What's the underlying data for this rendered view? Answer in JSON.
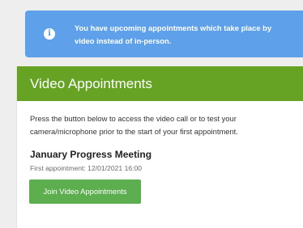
{
  "alert": {
    "icon": "info-icon",
    "icon_glyph": "i",
    "text": "You have upcoming appointments which take place by video instead of in-person."
  },
  "card": {
    "title": "Video Appointments",
    "intro": "Press the button below to access the video call or to test your camera/microphone prior to the start of your first appointment.",
    "meeting_title": "January Progress Meeting",
    "first_appointment": "First appointment: 12/01/2021 16:00",
    "join_button_label": "Join Video Appointments"
  },
  "colors": {
    "alert_bg": "#5ea1ea",
    "header_bg": "#66a224",
    "button_bg": "#5cae4f",
    "page_bg": "#eeeeee"
  }
}
